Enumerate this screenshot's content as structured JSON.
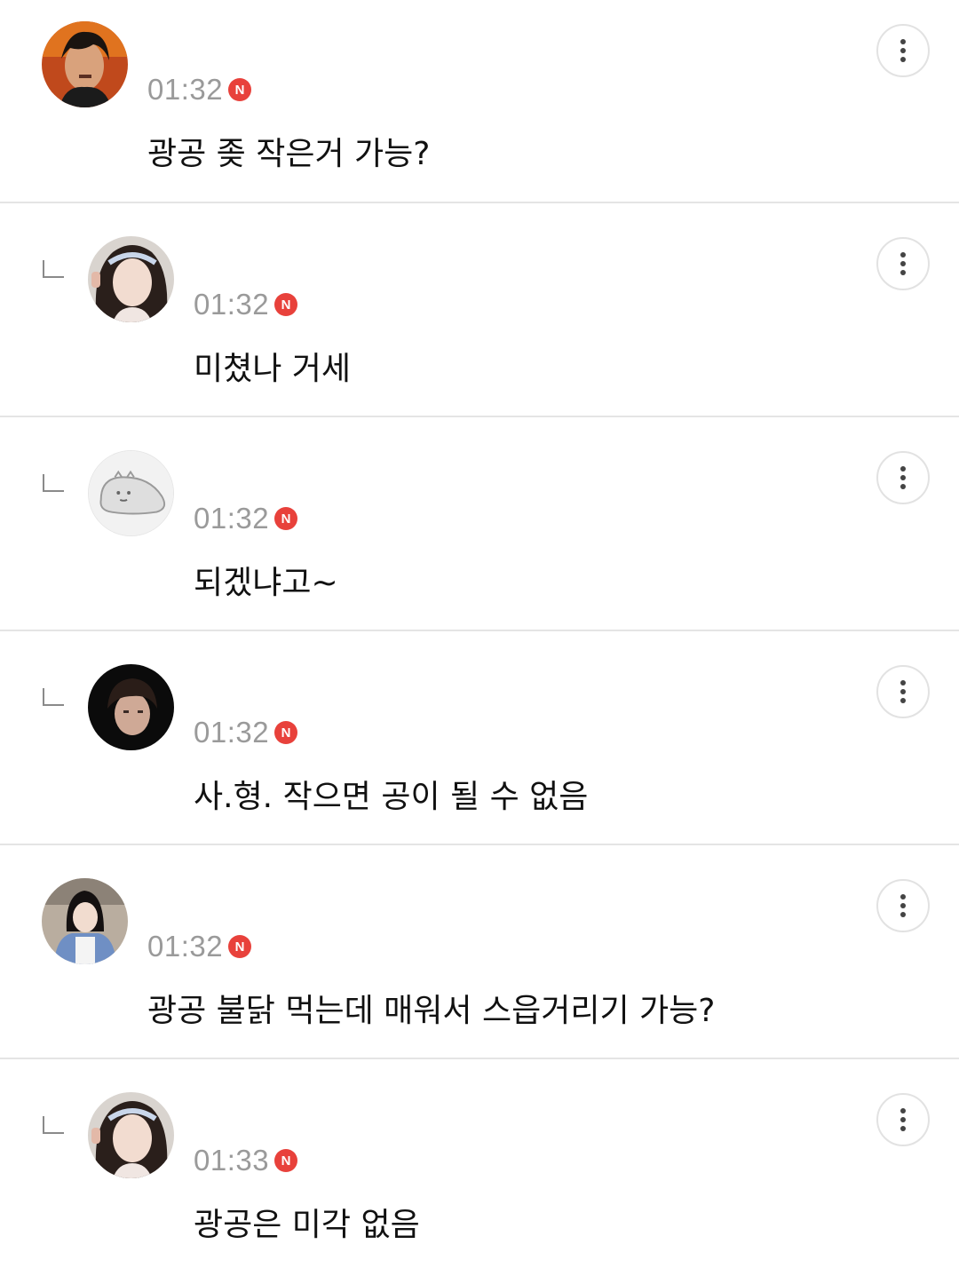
{
  "comments": [
    {
      "time": "01:32",
      "badge": "N",
      "text": "광공 좆 작은거 가능?",
      "is_reply": false,
      "avatar": "red-stage-man-avatar"
    },
    {
      "time": "01:32",
      "badge": "N",
      "text": "미쳤나 거세",
      "is_reply": true,
      "avatar": "girl-hairband-avatar"
    },
    {
      "time": "01:32",
      "badge": "N",
      "text": "되겠냐고~",
      "is_reply": true,
      "avatar": "gray-seal-cartoon-avatar"
    },
    {
      "time": "01:32",
      "badge": "N",
      "text": "사.형. 작으면 공이 될 수 없음",
      "is_reply": true,
      "avatar": "dark-boy-avatar"
    },
    {
      "time": "01:32",
      "badge": "N",
      "text": "광공 불닭 먹는데 매워서 스읍거리기 가능?",
      "is_reply": false,
      "avatar": "girl-blue-jacket-avatar"
    },
    {
      "time": "01:33",
      "badge": "N",
      "text": "광공은 미각 없음",
      "is_reply": true,
      "avatar": "girl-hairband-avatar"
    }
  ],
  "colors": {
    "badge": "#e8413b",
    "time": "#9a9a9a",
    "divider": "#e4e4e4"
  },
  "icons": {
    "more": "more-vertical-icon",
    "reply": "reply-corner-icon",
    "new": "new-badge-icon"
  }
}
